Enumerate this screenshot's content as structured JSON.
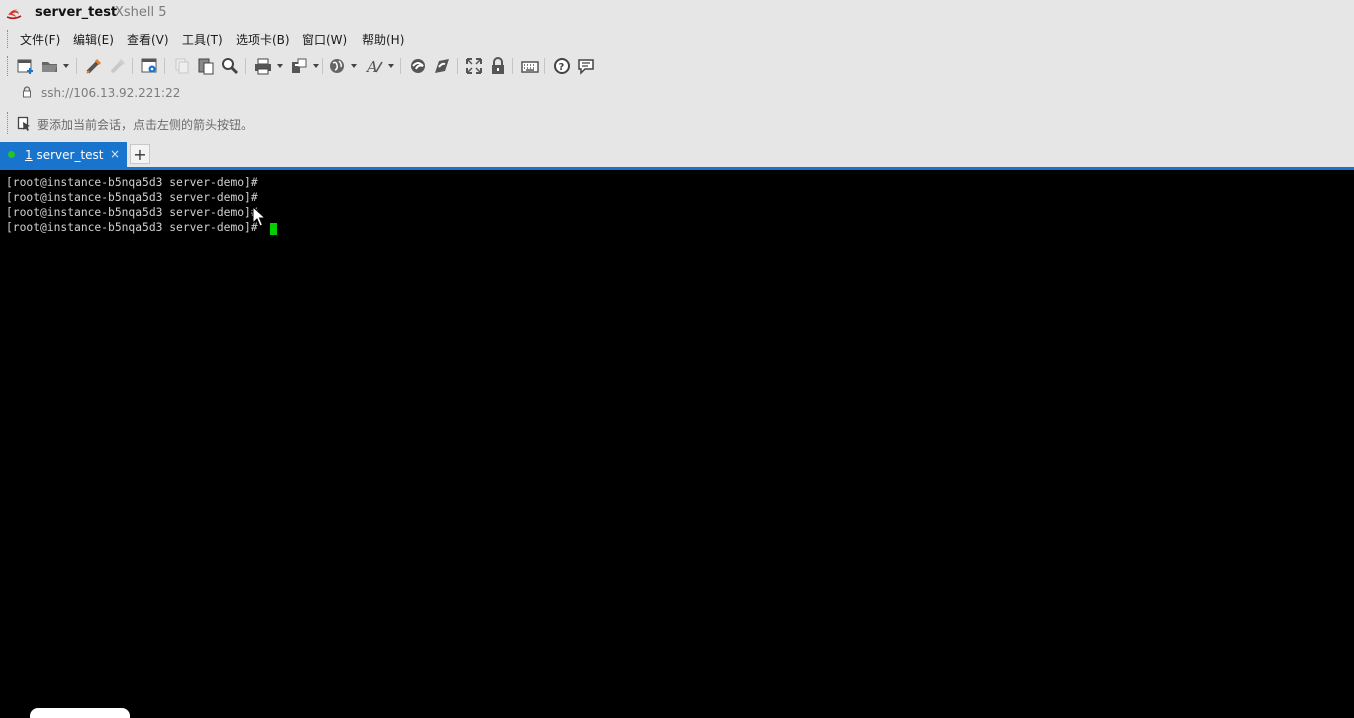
{
  "window": {
    "title": "server_test",
    "app_name": "Xshell 5",
    "logo_icon": "xshell-logo-icon"
  },
  "menu": [
    {
      "label": "文件(F)"
    },
    {
      "label": "编辑(E)"
    },
    {
      "label": "查看(V)"
    },
    {
      "label": "工具(T)"
    },
    {
      "label": "选项卡(B)"
    },
    {
      "label": "窗口(W)"
    },
    {
      "label": "帮助(H)"
    }
  ],
  "toolbar": {
    "buttons": [
      "new-session-icon",
      "open-folder-icon",
      "connect-icon",
      "disconnect-icon",
      "properties-icon",
      "copy-icon",
      "paste-icon",
      "find-icon",
      "print-icon",
      "transfer-icon",
      "globe-icon",
      "font-icon",
      "xftp-icon",
      "xagent-icon",
      "fullscreen-icon",
      "lock-icon",
      "keyboard-icon",
      "help-icon",
      "chat-icon"
    ]
  },
  "address": {
    "value": "ssh://106.13.92.221:22"
  },
  "hint": {
    "text": "要添加当前会话，点击左侧的箭头按钮。"
  },
  "tabs": [
    {
      "number": "1",
      "label": "server_test",
      "close": "×",
      "status_color": "#22c522"
    }
  ],
  "new_tab_label": "+",
  "terminal": {
    "lines": [
      "[root@instance-b5nqa5d3 server-demo]#",
      "[root@instance-b5nqa5d3 server-demo]#",
      "[root@instance-b5nqa5d3 server-demo]#",
      "[root@instance-b5nqa5d3 server-demo]#"
    ],
    "cursor_color": "#00d000"
  },
  "colors": {
    "accent": "#1874cd",
    "chrome_bg": "#e6e6e6",
    "terminal_bg": "#000000"
  }
}
